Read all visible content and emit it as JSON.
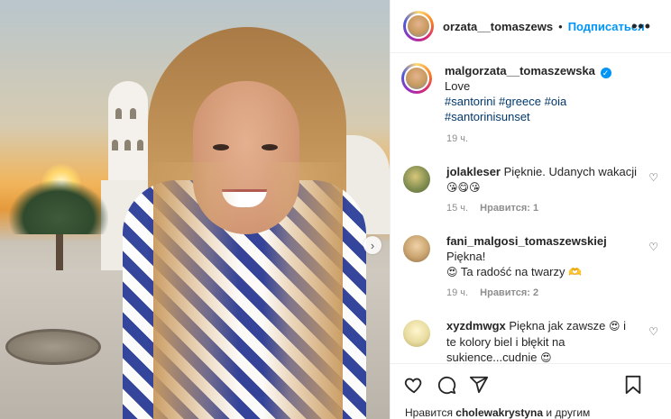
{
  "post": {
    "image_alt": "Woman with long blonde hair in a blue and white patterned dress in front of a white church at sunset",
    "next_arrow": "›"
  },
  "header": {
    "username": "orzata__tomaszews",
    "separator": "•",
    "follow_label": "Подписаться",
    "more_label": "•••"
  },
  "caption": {
    "username": "malgorzata__tomaszewska",
    "verified_mark": "✓",
    "text": "Love",
    "hashtags": [
      "#santorini",
      "#greece",
      "#oia",
      "#santorinisunset"
    ],
    "time": "19 ч."
  },
  "comments": [
    {
      "username": "jolakleser",
      "text": "Pięknie. Udanych wakacji",
      "emoji": "😘😋😘",
      "time": "15 ч.",
      "likes": "Нравится: 1",
      "avatar_color": "#a3a16a"
    },
    {
      "username": "fani_malgosi_tomaszewskiej",
      "text": "Piękna!",
      "emoji_mid": "😍",
      "text2": "Ta radość na twarzy",
      "emoji_end": "🫶",
      "time": "19 ч.",
      "likes": "Нравится: 2",
      "avatar_color": "#c9a46f"
    },
    {
      "username": "xyzdmwgx",
      "text": "Piękna jak zawsze",
      "emoji_mid": "😍",
      "text2": "i te kolory biel i błękit na sukience...cudnie",
      "emoji_end": "😍",
      "avatar_color": "#e8dca0"
    }
  ],
  "actions": {
    "like_icon": "heart-icon",
    "comment_icon": "comment-icon",
    "share_icon": "share-icon",
    "save_icon": "bookmark-icon"
  },
  "likes_line": {
    "prefix": "Нравится",
    "user": "cholewakrystyna",
    "suffix": "и другим"
  }
}
